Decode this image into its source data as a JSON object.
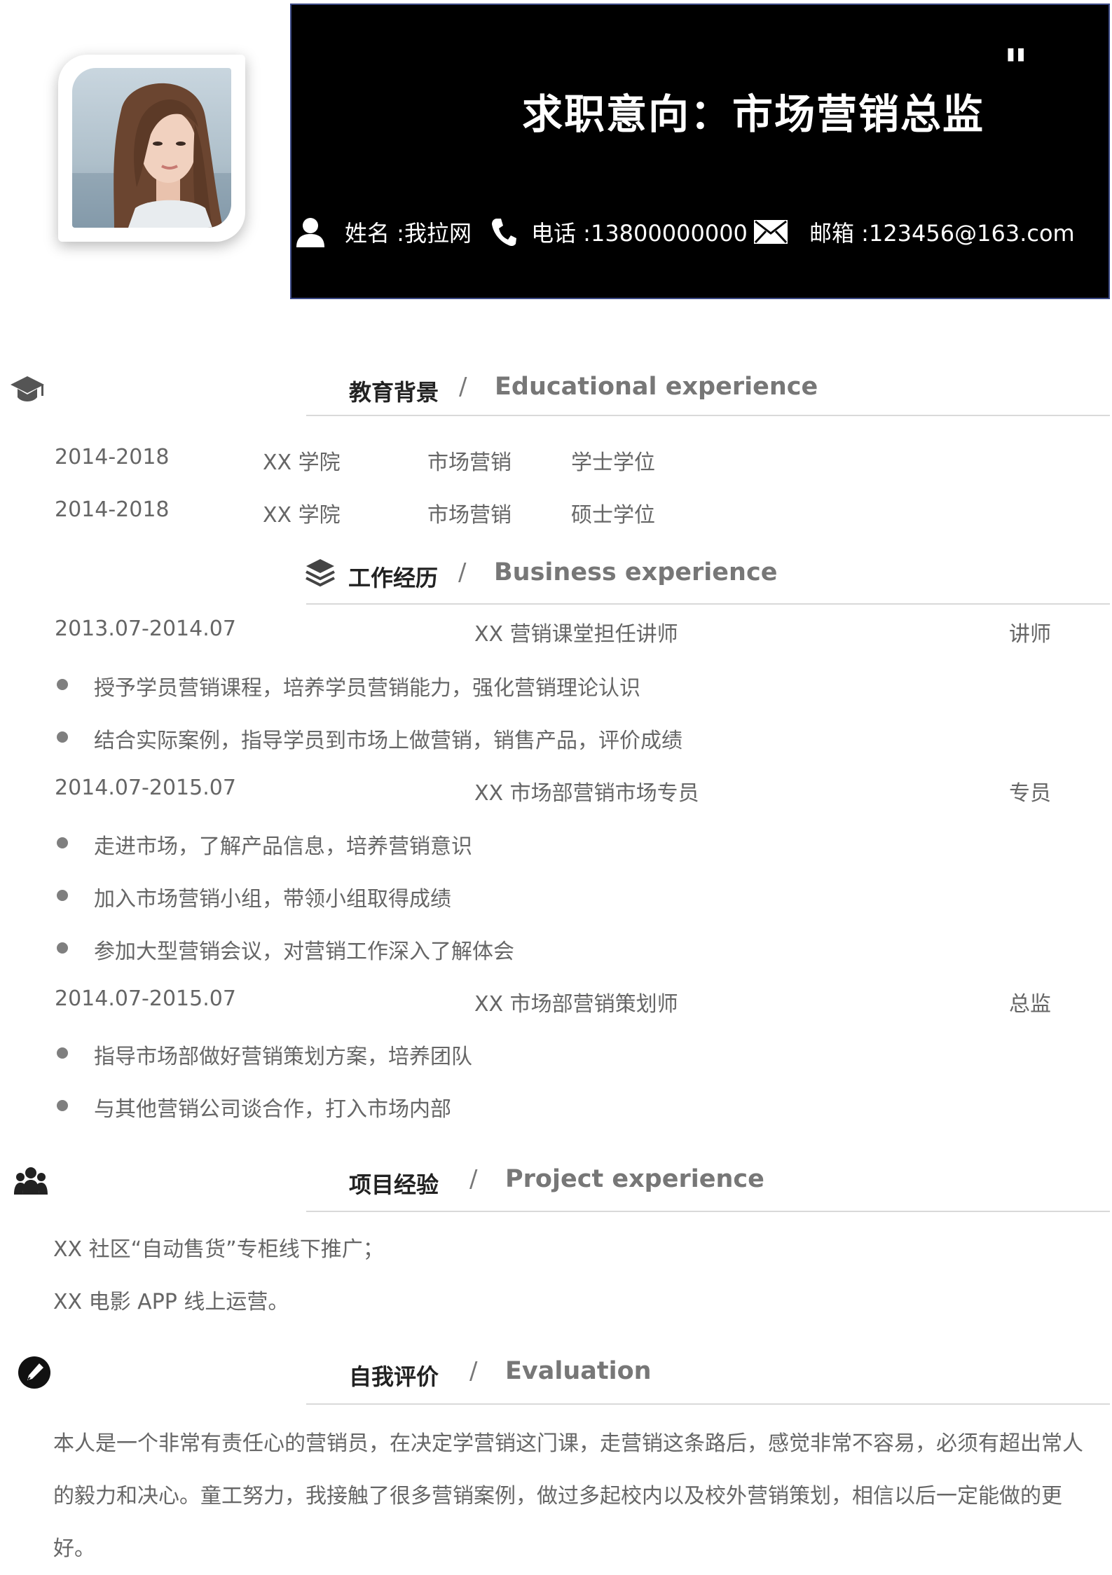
{
  "header": {
    "job_intention": "求职意向：市场营销总监",
    "quote_mark": "\"",
    "name": "姓名 :我拉网",
    "phone": "电话 :13800000000",
    "email": "邮箱 :123456@163.com"
  },
  "education": {
    "title_cn": "教育背景",
    "title_en": "Educational experience",
    "rows": [
      {
        "period": "2014-2018",
        "school": "XX 学院",
        "major": "市场营销",
        "degree": "学士学位"
      },
      {
        "period": "2014-2018",
        "school": "XX 学院",
        "major": "市场营销",
        "degree": "硕士学位"
      }
    ]
  },
  "work": {
    "title_cn": "工作经历",
    "title_en": "Business experience",
    "jobs": [
      {
        "period": "2013.07-2014.07",
        "position": "XX 营销课堂担任讲师",
        "role": "讲师",
        "duties": [
          "授予学员营销课程，培养学员营销能力，强化营销理论认识",
          "结合实际案例，指导学员到市场上做营销，销售产品，评价成绩"
        ]
      },
      {
        "period": "2014.07-2015.07",
        "position": "XX 市场部营销市场专员",
        "role": "专员",
        "duties": [
          "走进市场，了解产品信息，培养营销意识",
          "加入市场营销小组，带领小组取得成绩",
          "参加大型营销会议，对营销工作深入了解体会"
        ]
      },
      {
        "period": "2014.07-2015.07",
        "position": "XX 市场部营销策划师",
        "role": "总监",
        "duties": [
          "指导市场部做好营销策划方案，培养团队",
          "与其他营销公司谈合作，打入市场内部"
        ]
      }
    ]
  },
  "projects": {
    "title_cn": "项目经验",
    "title_en": "Project experience",
    "items": [
      "XX 社区“自动售货”专柜线下推广；",
      "XX 电影 APP 线上运营。"
    ]
  },
  "evaluation": {
    "title_cn": "自我评价",
    "title_en": "Evaluation",
    "text": "本人是一个非常有责任心的营销员，在决定学营销这门课，走营销这条路后，感觉非常不容易，必须有超出常人的毅力和决心。童工努力，我接触了很多营销案例，做过多起校内以及校外营销策划，相信以后一定能做的更好。"
  },
  "slash": "/"
}
